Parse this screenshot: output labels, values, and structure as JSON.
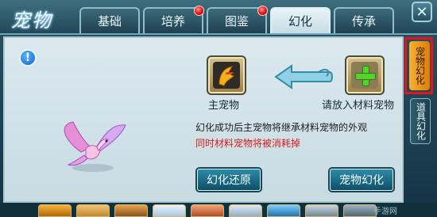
{
  "app": {
    "title_glyph": "宠物"
  },
  "tabs": [
    {
      "label": "基础",
      "active": false,
      "badge": false
    },
    {
      "label": "培养",
      "active": false,
      "badge": true
    },
    {
      "label": "图鉴",
      "active": false,
      "badge": true
    },
    {
      "label": "幻化",
      "active": true,
      "badge": false
    },
    {
      "label": "传承",
      "active": false,
      "badge": false
    }
  ],
  "close_label": "✕",
  "info_label": "!",
  "slots": {
    "main_label": "主宠物",
    "material_label": "请放入材料宠物"
  },
  "text": {
    "description": "幻化成功后主宠物将继承材料宠物的外观",
    "warning": "同时材料宠物将被消耗掉"
  },
  "buttons": {
    "restore": "幻化还原",
    "transform": "宠物幻化"
  },
  "side_tabs": [
    {
      "label": "宠物幻化",
      "active": true
    },
    {
      "label": "道具幻化",
      "active": false
    }
  ],
  "watermark": "手游网",
  "colors": {
    "accent": "#2d8aa8",
    "warning": "#d81c1c",
    "active_tab": "#e07c08",
    "badge": "#d40d0d"
  }
}
